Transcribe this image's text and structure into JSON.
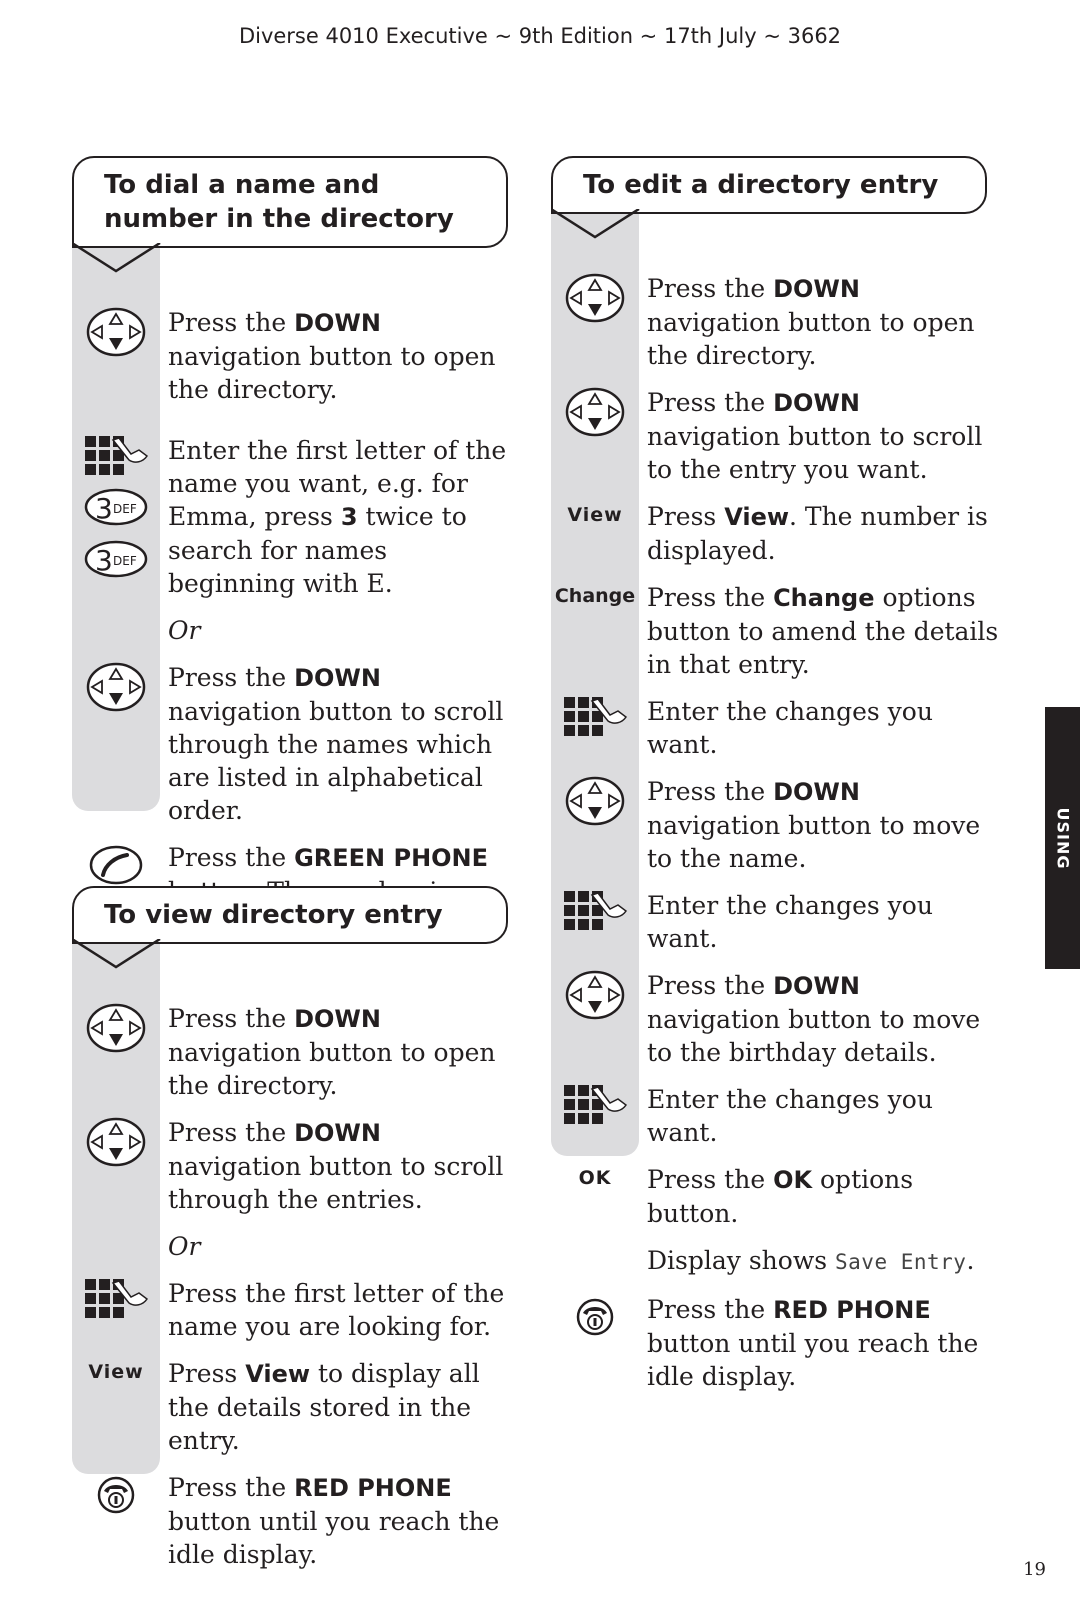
{
  "header": {
    "running_title": "Diverse 4010 Executive ~ 9th Edition ~ 17th July ~ 3662"
  },
  "side_tab": {
    "label": "USING"
  },
  "page_number": "19",
  "sections": {
    "dial": {
      "title": "To dial a name and number in the directory",
      "steps": [
        {
          "icon": "navigation-down-icon",
          "pre": "Press the ",
          "bold": "DOWN",
          "post": " navigation button to open the directory."
        },
        {
          "icon": "keypad-icon",
          "extra_icons": [
            "key-3-def-icon",
            "key-3-def-icon"
          ],
          "key_3_label": "3",
          "key_3_sub": "DEF",
          "pre": "Enter the first letter of the name you want, e.g. for Emma, press ",
          "bold": "3",
          "post": " twice to search for names beginning with E."
        },
        {
          "or": "Or"
        },
        {
          "icon": "navigation-down-icon",
          "pre": "Press the ",
          "bold": "DOWN",
          "post": " navigation button to scroll through the names which are listed in alphabetical order."
        },
        {
          "icon": "green-phone-icon",
          "pre": "Press the ",
          "bold": "GREEN PHONE",
          "post": " button. The number is dialled."
        }
      ]
    },
    "view": {
      "title": "To view directory entry",
      "steps": [
        {
          "icon": "navigation-down-icon",
          "pre": "Press the ",
          "bold": "DOWN",
          "post": " navigation button to open the directory."
        },
        {
          "icon": "navigation-down-icon",
          "pre": "Press the ",
          "bold": "DOWN",
          "post": " navigation button to scroll through the entries."
        },
        {
          "or": "Or"
        },
        {
          "icon": "keypad-icon",
          "text": "Press the first letter of the name you are looking for."
        },
        {
          "key_label": "View",
          "pre": "Press ",
          "bold": "View",
          "post": " to display all the details stored in the entry."
        },
        {
          "icon": "red-phone-icon",
          "pre": "Press the ",
          "bold": "RED PHONE",
          "post": " button until you reach the idle display."
        }
      ]
    },
    "edit": {
      "title": "To edit a directory entry",
      "steps": [
        {
          "icon": "navigation-down-icon",
          "pre": "Press the ",
          "bold": "DOWN",
          "post": " navigation button to open the directory."
        },
        {
          "icon": "navigation-down-icon",
          "pre": "Press the ",
          "bold": "DOWN",
          "post": " navigation button to scroll to the entry you want."
        },
        {
          "key_label": "View",
          "pre": "Press ",
          "bold": "View",
          "post": ". The number is displayed."
        },
        {
          "key_label": "Change",
          "pre": "Press the ",
          "bold": "Change",
          "post": " options button to amend the details in that entry."
        },
        {
          "icon": "keypad-icon",
          "text": "Enter the changes you want."
        },
        {
          "icon": "navigation-down-icon",
          "pre": "Press the ",
          "bold": "DOWN",
          "post": " navigation button to move to the name."
        },
        {
          "icon": "keypad-icon",
          "text": "Enter the changes you want."
        },
        {
          "icon": "navigation-down-icon",
          "pre": "Press the ",
          "bold": "DOWN",
          "post": " navigation button to move to the birthday details."
        },
        {
          "icon": "keypad-icon",
          "text": "Enter the changes you want."
        },
        {
          "key_label": "OK",
          "pre": "Press the ",
          "bold": "OK",
          "post": " options button."
        },
        {
          "pre": "Display shows ",
          "lcd": "Save Entry",
          "post": "."
        },
        {
          "icon": "red-phone-icon",
          "pre": "Press the ",
          "bold": "RED PHONE",
          "post": " button until you reach the idle display."
        }
      ]
    }
  }
}
